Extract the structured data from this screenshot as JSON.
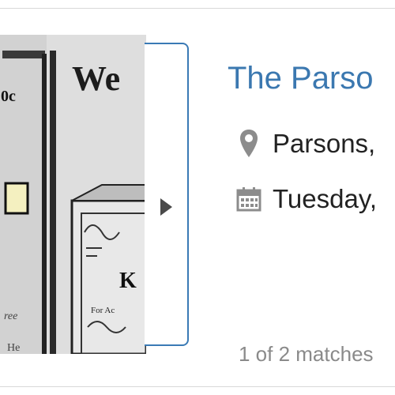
{
  "result": {
    "title": "The Parso",
    "location": "Parsons,",
    "date": "Tuesday,",
    "matches": "1 of 2 matches"
  },
  "thumbnail": {
    "alt_text_fragments": [
      "We",
      "0c",
      "K",
      "ree",
      "He",
      "For Ac"
    ]
  },
  "icons": {
    "location": "map-marker-icon",
    "date": "calendar-icon",
    "next": "play-arrow-icon"
  },
  "colors": {
    "title": "#3b78b0",
    "nav_border": "#3a7ab5",
    "muted_text": "#8a8a8a",
    "icon_gray": "#8c8c8c"
  }
}
